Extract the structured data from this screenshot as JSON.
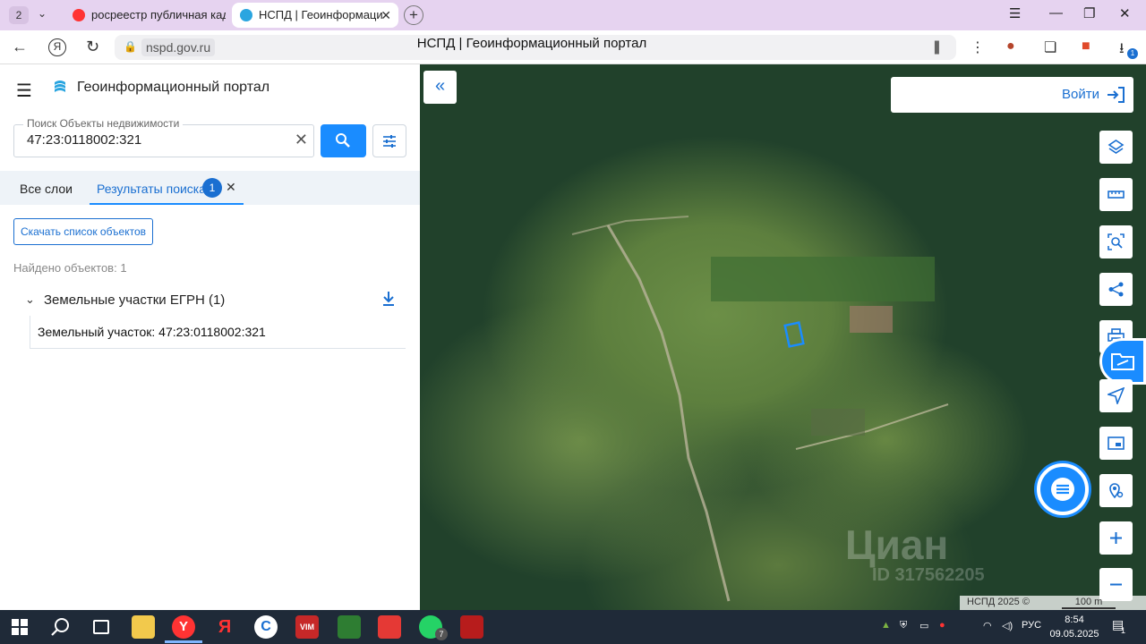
{
  "browser": {
    "tab_count": "2",
    "tabs": [
      {
        "title": "росреестр публичная кад",
        "active": false
      },
      {
        "title": "НСПД | Геоинформаци",
        "active": true
      }
    ],
    "url": "nspd.gov.ru",
    "page_title": "НСПД | Геоинформационный портал",
    "downloads_badge": "1"
  },
  "sidebar": {
    "app_title": "Геоинформационный портал",
    "search": {
      "label": "Поиск Объекты недвижимости",
      "value": "47:23:0118002:321"
    },
    "tabs": {
      "all_layers": "Все слои",
      "results": "Результаты поиска",
      "results_count": "1"
    },
    "download_list_label": "Скачать список объектов",
    "found_text": "Найдено объектов: 1",
    "group": {
      "title": "Земельные участки ЕГРН (1)",
      "items": [
        "Земельный участок: 47:23:0118002:321"
      ]
    }
  },
  "map": {
    "login_label": "Войти",
    "attribution": "НСПД 2025 ©",
    "scale_label": "100 m",
    "watermark": "Циан",
    "watermark_id": "ID 317562205",
    "tools": [
      "layers-icon",
      "ruler-icon",
      "area-search-icon",
      "share-icon",
      "print-icon",
      "locate-icon",
      "minimap-icon",
      "geo-search-icon",
      "zoom-in-icon",
      "zoom-out-icon"
    ]
  },
  "taskbar": {
    "whatsapp_badge": "7",
    "language": "РУС",
    "time": "8:54",
    "date": "09.05.2025",
    "notifications_badge": "1"
  },
  "colors": {
    "accent": "#1a8cff",
    "accent_dark": "#1a6fd1",
    "tabbar": "#e6d3f0",
    "taskbar": "#1f2a38"
  }
}
